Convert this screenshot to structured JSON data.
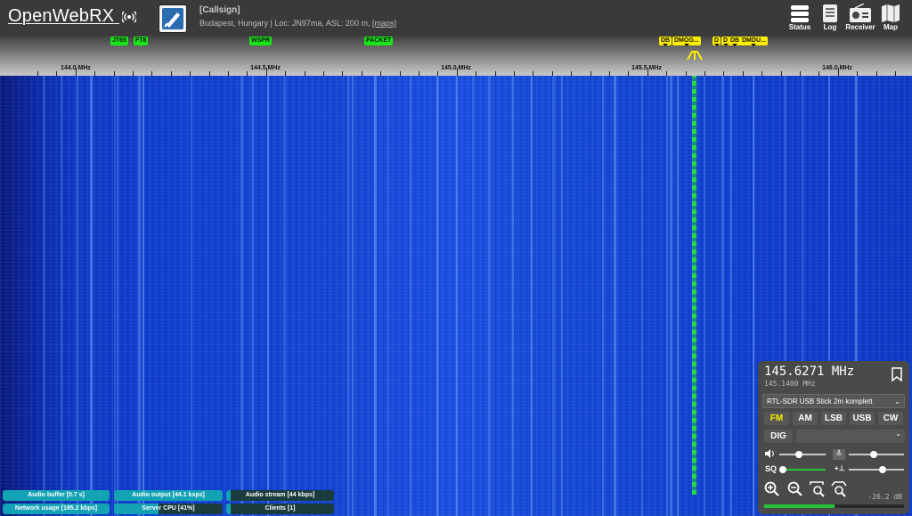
{
  "header": {
    "logo_text": "OpenWebRX",
    "receiver_title": "[Callsign]",
    "receiver_desc": "Budapest, Hungary | Loc: JN97ma, ASL: 200 m, ",
    "maps_link": "[maps]",
    "buttons": [
      {
        "label": "Status",
        "icon": "status-icon"
      },
      {
        "label": "Log",
        "icon": "log-icon"
      },
      {
        "label": "Receiver",
        "icon": "receiver-icon"
      },
      {
        "label": "Map",
        "icon": "map-icon"
      }
    ]
  },
  "scale": {
    "ticks": [
      "144.0 MHz",
      "144.5 MHz",
      "145.0 MHz",
      "145.5 MHz",
      "146.0 MHz"
    ],
    "bookmarks_green": [
      "JT65",
      "FT8",
      "WSPR",
      "PACKET"
    ],
    "bookmarks_yellow": [
      "DB",
      "DMOG...",
      "D",
      "D",
      "DB",
      "DMDU..."
    ]
  },
  "panel": {
    "frequency": "145.6271 MHz",
    "center_frequency": "145.1400 MHz",
    "profile": "RTL-SDR USB Stick 2m komplett",
    "modes": [
      "FM",
      "AM",
      "LSB",
      "USB",
      "CW"
    ],
    "active_mode": "FM",
    "dig_label": "DIG",
    "squelch_label": "SQ",
    "db_readout": "-26.2 dB"
  },
  "status": {
    "audio_buffer": "Audio buffer [0.7 s]",
    "audio_output": "Audio output [44.1 ksps]",
    "audio_stream": "Audio stream [44 kbps]",
    "network_usage": "Network usage [195.2 kbps]",
    "server_cpu": "Server CPU [41%]",
    "clients": "Clients [1]"
  },
  "colors": {
    "accent": "#ffee00",
    "digimode_bookmark": "#19e419",
    "signal": "#27d84b",
    "status_bar": "#14a3b4"
  }
}
